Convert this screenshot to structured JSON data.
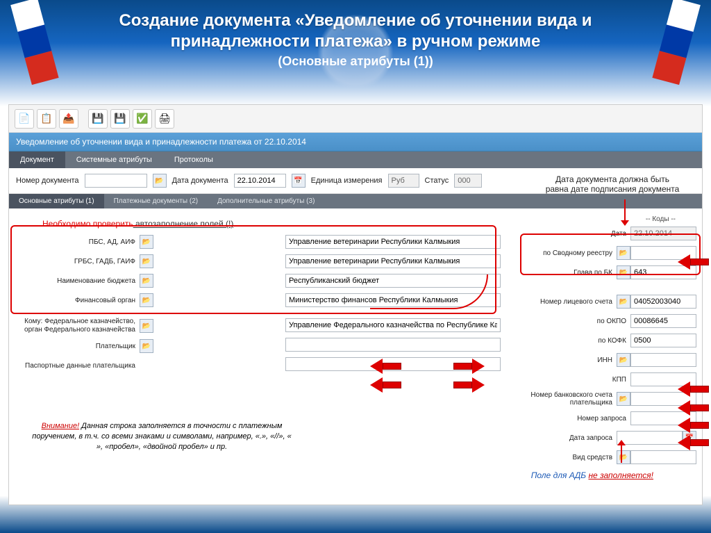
{
  "title": {
    "line1": "Создание документа «Уведомление об уточнении вида и",
    "line2": "принадлежности платежа» в ручном режиме",
    "sub": "(Основные атрибуты (1))"
  },
  "doc_header": "Уведомление об уточнении вида и принадлежности платежа от 22.10.2014",
  "tabs_main": {
    "t1": "Документ",
    "t2": "Системные атрибуты",
    "t3": "Протоколы"
  },
  "hdr": {
    "num_lbl": "Номер документа",
    "num_val": "",
    "date_lbl": "Дата документа",
    "date_val": "22.10.2014",
    "unit_lbl": "Единица измерения",
    "unit_val": "Руб",
    "status_lbl": "Статус",
    "status_val": "000"
  },
  "tabs_sub": {
    "t1": "Основные атрибуты (1)",
    "t2": "Платежные документы (2)",
    "t3": "Дополнительные атрибуты (3)"
  },
  "annot_check": {
    "red": "Необходимо проверить",
    "rest": " автозаполнение полей (!)"
  },
  "left": {
    "r1_lbl": "ПБС, АД, АИФ",
    "r1_val": "Управление ветеринарии Республики Калмыкия",
    "r2_lbl": "ГРБС, ГАДБ, ГАИФ",
    "r2_val": "Управление ветеринарии Республики Калмыкия",
    "r3_lbl": "Наименование бюджета",
    "r3_val": "Республиканский бюджет",
    "r4_lbl": "Финансовый орган",
    "r4_val": "Министерство финансов Республики Калмыкия",
    "r5_lbl": "Кому: Федеральное казначейство, орган Федерального казначейства",
    "r5_val": "Управление Федерального казначейства по Республике Калмыкия",
    "r6_lbl": "Плательщик",
    "r6_val": "",
    "r7_lbl": "Паспортные данные плательщика",
    "r7_val": ""
  },
  "codes_hdr": "-- Коды --",
  "right": {
    "r1_lbl": "Дата",
    "r1_val": "22.10.2014",
    "r2_lbl": "по Сводному реестру",
    "r2_val": "",
    "r3_lbl": "Глава по БК",
    "r3_val": "643",
    "r4_lbl": "Номер лицевого счета",
    "r4_val": "04052003040",
    "r5_lbl": "по ОКПО",
    "r5_val": "00086645",
    "r6_lbl": "по КОФК",
    "r6_val": "0500",
    "r7_lbl": "ИНН",
    "r7_val": "",
    "r8_lbl": "КПП",
    "r8_val": "",
    "r9_lbl": "Номер банковского счета плательщика",
    "r9_val": "",
    "r10_lbl": "Номер запроса",
    "r10_val": "",
    "r11_lbl": "Дата запроса",
    "r11_val": "",
    "r12_lbl": "Вид средств",
    "r12_val": ""
  },
  "note_top": {
    "l1": "Дата документа должна быть",
    "l2": "равна дате подписания документа"
  },
  "warn": {
    "head": "Внимание!",
    "body": " Данная строка заполняется в точности с платежным поручением, в т.ч. со всеми знаками и символами, например, «.», «//», « », «пробел», «двойной пробел» и пр."
  },
  "note_bottom": {
    "pre": "Поле для АДБ ",
    "u": "не заполняется!"
  }
}
